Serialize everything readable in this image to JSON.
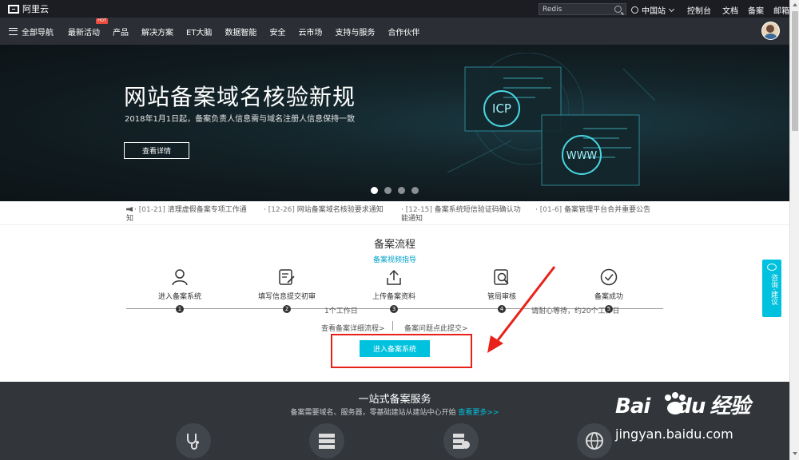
{
  "topbar": {
    "logo_text": "阿里云",
    "search_value": "Redis",
    "region": "中国站",
    "links": [
      "控制台",
      "文档",
      "备案",
      "邮箱"
    ]
  },
  "nav": {
    "all_nav": "全部导航",
    "items": [
      {
        "label": "最新活动",
        "badge": "HOT"
      },
      {
        "label": "产品"
      },
      {
        "label": "解决方案"
      },
      {
        "label": "ET大脑"
      },
      {
        "label": "数据智能"
      },
      {
        "label": "安全"
      },
      {
        "label": "云市场"
      },
      {
        "label": "支持与服务"
      },
      {
        "label": "合作伙伴"
      }
    ]
  },
  "banner": {
    "title": "网站备案域名核验新规",
    "subtitle": "2018年1月1日起，备案负责人信息需与域名注册人信息保持一致",
    "button": "查看详情",
    "art_labels": [
      "ICP",
      "WWW"
    ],
    "dots": 4,
    "active_dot": 0
  },
  "notices": [
    {
      "date": "[01-21]",
      "text": "清理虚假备案专项工作通",
      "wrap": "知"
    },
    {
      "date": "[12-26]",
      "text": "网站备案域名核验要求通知",
      "wrap": ""
    },
    {
      "date": "[12-15]",
      "text": "备案系统短信验证码确认功",
      "wrap": "能通知"
    },
    {
      "date": "[01-6]",
      "text": "备案管理平台合并重要公告",
      "wrap": ""
    }
  ],
  "process": {
    "title": "备案流程",
    "video_link": "备案视频指导",
    "steps": [
      {
        "label": "进入备案系统",
        "num": "1",
        "icon": "user-icon"
      },
      {
        "label": "填写信息提交初审",
        "num": "2",
        "icon": "edit-icon"
      },
      {
        "label": "上传备案资料",
        "num": "3",
        "icon": "upload-icon"
      },
      {
        "label": "管局审核",
        "num": "4",
        "icon": "review-icon"
      },
      {
        "label": "备案成功",
        "num": "5",
        "icon": "check-icon"
      }
    ],
    "note_workday": "1个工作日",
    "note_wait": "请耐心等待，约20个工作日",
    "detail_link": "查看备案详细流程>",
    "question_link": "备案问题点此提交>",
    "enter_button": "进入备案系统"
  },
  "float_widget": {
    "text": "咨询·建议"
  },
  "services": {
    "title": "一站式备案服务",
    "subtitle": "备案需要域名、服务器，零基础建站从建站中心开始",
    "more": "查看更多>>",
    "icons": [
      "stethoscope-icon",
      "server-icon",
      "host-icon",
      "web-globe-icon"
    ]
  },
  "watermark": {
    "brand_left": "Bai",
    "brand_mid": "du",
    "brand_right": "经验",
    "url": "jingyan.baidu.com"
  },
  "colors": {
    "accent": "#00c1de",
    "link": "#00a2ca",
    "annotation_red": "#e8211a",
    "topbar": "#1b1d22",
    "navbar": "#2b2e34",
    "footer_dark": "#32363b"
  }
}
